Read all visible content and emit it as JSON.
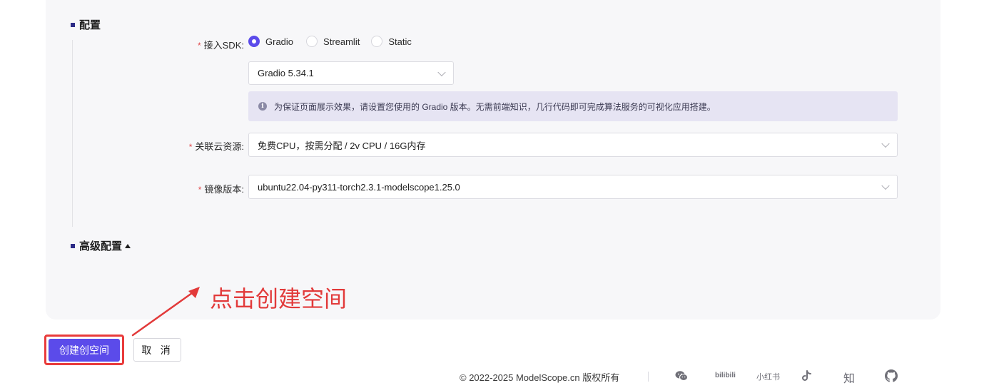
{
  "sections": {
    "config_title": "配置",
    "advanced_title": "高级配置"
  },
  "sdk": {
    "label": "接入SDK",
    "colon": ":",
    "required": "*",
    "options": [
      "Gradio",
      "Streamlit",
      "Static"
    ],
    "selected": "Gradio"
  },
  "gradio_version": {
    "value": "Gradio 5.34.1"
  },
  "info": {
    "text": "为保证页面展示效果，请设置您使用的 Gradio 版本。无需前端知识，几行代码即可完成算法服务的可视化应用搭建。",
    "icon": "info-icon"
  },
  "cloud_resource": {
    "label": "关联云资源",
    "colon": ":",
    "required": "*",
    "value": "免费CPU，按需分配 / 2v CPU / 16G内存"
  },
  "image_version": {
    "label": "镜像版本",
    "colon": ":",
    "required": "*",
    "value": "ubuntu22.04-py311-torch2.3.1-modelscope1.25.0"
  },
  "annotation": {
    "text": "点击创建空间",
    "color": "#e23a3a"
  },
  "buttons": {
    "create": "创建创空间",
    "cancel": "取 消"
  },
  "footer": {
    "copyright": "© 2022-2025 ModelScope.cn 版权所有",
    "social": {
      "bilibili": "bilibili",
      "xiaohongshu": "小红书",
      "zhihu": "知"
    }
  },
  "colors": {
    "primary": "#5b4bea",
    "required": "#e0484a",
    "panel_bg": "#f7f7f9",
    "info_bg": "#e6e4f3"
  }
}
